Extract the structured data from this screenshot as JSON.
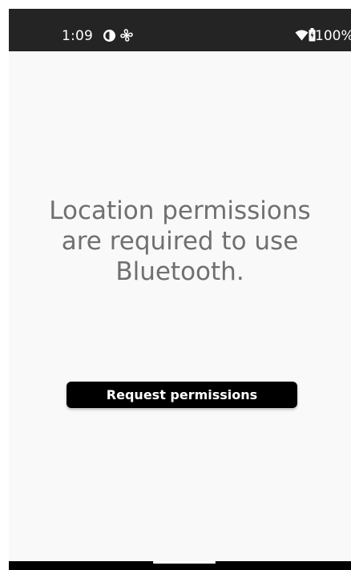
{
  "status_bar": {
    "time": "1:09",
    "battery_percent": "100%",
    "icons": [
      "data-saver-icon",
      "fan-icon",
      "wifi-icon",
      "battery-icon"
    ]
  },
  "main": {
    "message_lines": [
      "Location permissions",
      "are required to use",
      "Bluetooth."
    ],
    "request_button_label": "Request permissions"
  },
  "colors": {
    "status_bar_bg": "#242424",
    "screen_bg": "#f9f9f9",
    "message_text": "#707070",
    "button_bg": "#000000",
    "button_text": "#ffffff"
  }
}
